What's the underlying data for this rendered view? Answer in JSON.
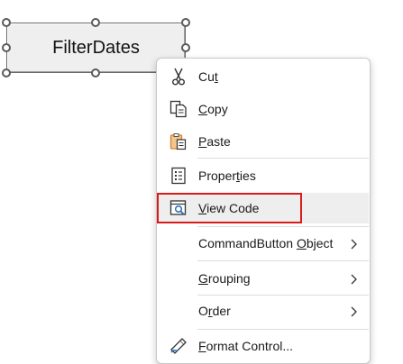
{
  "control": {
    "label": "FilterDates"
  },
  "menu": {
    "items": [
      {
        "name": "cut",
        "prefix": "Cu",
        "ul": "t",
        "suffix": "",
        "icon": "scissors-icon"
      },
      {
        "name": "copy",
        "prefix": "",
        "ul": "C",
        "suffix": "opy",
        "icon": "copy-icon"
      },
      {
        "name": "paste",
        "prefix": "",
        "ul": "P",
        "suffix": "aste",
        "icon": "paste-icon"
      },
      {
        "name": "properties",
        "prefix": "Proper",
        "ul": "t",
        "suffix": "ies",
        "icon": "properties-icon"
      },
      {
        "name": "view-code",
        "prefix": "",
        "ul": "V",
        "suffix": "iew Code",
        "icon": "view-code-icon"
      },
      {
        "name": "commandbutton-object",
        "prefix": "CommandButton ",
        "ul": "O",
        "suffix": "bject",
        "submenu": true
      },
      {
        "name": "grouping",
        "prefix": "",
        "ul": "G",
        "suffix": "rouping",
        "submenu": true
      },
      {
        "name": "order",
        "prefix": "O",
        "ul": "r",
        "suffix": "der",
        "submenu": true
      },
      {
        "name": "format-control",
        "prefix": "",
        "ul": "F",
        "suffix": "ormat Control...",
        "icon": "format-control-icon"
      }
    ]
  },
  "colors": {
    "highlight_border": "#d81b1b",
    "hover_background": "#eeeeee",
    "paste_icon_orange": "#d9822b",
    "view_code_icon_blue": "#2b6cb8"
  }
}
